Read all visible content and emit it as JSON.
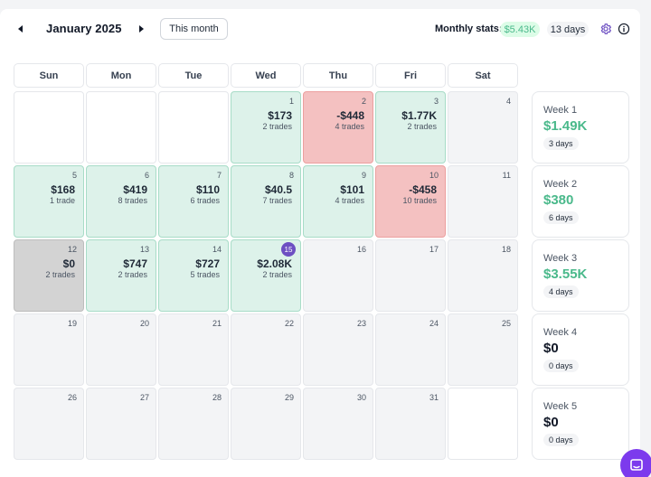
{
  "header": {
    "month_title": "January 2025",
    "this_month_label": "This month",
    "stats_label": "Monthly stats:",
    "stats_amount": "$5.43K",
    "stats_days": "13 days"
  },
  "weekdays": [
    "Sun",
    "Mon",
    "Tue",
    "Wed",
    "Thu",
    "Fri",
    "Sat"
  ],
  "weeks": [
    {
      "days": [
        {
          "date": "",
          "amount": "",
          "trades": "",
          "status": "blank"
        },
        {
          "date": "",
          "amount": "",
          "trades": "",
          "status": "blank"
        },
        {
          "date": "",
          "amount": "",
          "trades": "",
          "status": "blank"
        },
        {
          "date": "1",
          "amount": "$173",
          "trades": "2 trades",
          "status": "profit"
        },
        {
          "date": "2",
          "amount": "-$448",
          "trades": "4 trades",
          "status": "loss"
        },
        {
          "date": "3",
          "amount": "$1.77K",
          "trades": "2 trades",
          "status": "profit"
        },
        {
          "date": "4",
          "amount": "",
          "trades": "",
          "status": "empty"
        }
      ],
      "summary": {
        "label": "Week 1",
        "amount": "$1.49K",
        "days": "3 days",
        "positive": true
      }
    },
    {
      "days": [
        {
          "date": "5",
          "amount": "$168",
          "trades": "1 trade",
          "status": "profit"
        },
        {
          "date": "6",
          "amount": "$419",
          "trades": "8 trades",
          "status": "profit"
        },
        {
          "date": "7",
          "amount": "$110",
          "trades": "6 trades",
          "status": "profit"
        },
        {
          "date": "8",
          "amount": "$40.5",
          "trades": "7 trades",
          "status": "profit"
        },
        {
          "date": "9",
          "amount": "$101",
          "trades": "4 trades",
          "status": "profit"
        },
        {
          "date": "10",
          "amount": "-$458",
          "trades": "10 trades",
          "status": "loss"
        },
        {
          "date": "11",
          "amount": "",
          "trades": "",
          "status": "empty"
        }
      ],
      "summary": {
        "label": "Week 2",
        "amount": "$380",
        "days": "6 days",
        "positive": true
      }
    },
    {
      "days": [
        {
          "date": "12",
          "amount": "$0",
          "trades": "2 trades",
          "status": "flat"
        },
        {
          "date": "13",
          "amount": "$747",
          "trades": "2 trades",
          "status": "profit"
        },
        {
          "date": "14",
          "amount": "$727",
          "trades": "5 trades",
          "status": "profit"
        },
        {
          "date": "15",
          "amount": "$2.08K",
          "trades": "2 trades",
          "status": "profit",
          "today": true
        },
        {
          "date": "16",
          "amount": "",
          "trades": "",
          "status": "empty"
        },
        {
          "date": "17",
          "amount": "",
          "trades": "",
          "status": "empty"
        },
        {
          "date": "18",
          "amount": "",
          "trades": "",
          "status": "empty"
        }
      ],
      "summary": {
        "label": "Week 3",
        "amount": "$3.55K",
        "days": "4 days",
        "positive": true
      }
    },
    {
      "days": [
        {
          "date": "19",
          "amount": "",
          "trades": "",
          "status": "empty"
        },
        {
          "date": "20",
          "amount": "",
          "trades": "",
          "status": "empty"
        },
        {
          "date": "21",
          "amount": "",
          "trades": "",
          "status": "empty"
        },
        {
          "date": "22",
          "amount": "",
          "trades": "",
          "status": "empty"
        },
        {
          "date": "23",
          "amount": "",
          "trades": "",
          "status": "empty"
        },
        {
          "date": "24",
          "amount": "",
          "trades": "",
          "status": "empty"
        },
        {
          "date": "25",
          "amount": "",
          "trades": "",
          "status": "empty"
        }
      ],
      "summary": {
        "label": "Week 4",
        "amount": "$0",
        "days": "0 days",
        "positive": false
      }
    },
    {
      "days": [
        {
          "date": "26",
          "amount": "",
          "trades": "",
          "status": "empty"
        },
        {
          "date": "27",
          "amount": "",
          "trades": "",
          "status": "empty"
        },
        {
          "date": "28",
          "amount": "",
          "trades": "",
          "status": "empty"
        },
        {
          "date": "29",
          "amount": "",
          "trades": "",
          "status": "empty"
        },
        {
          "date": "30",
          "amount": "",
          "trades": "",
          "status": "empty"
        },
        {
          "date": "31",
          "amount": "",
          "trades": "",
          "status": "empty"
        },
        {
          "date": "",
          "amount": "",
          "trades": "",
          "status": "blank"
        }
      ],
      "summary": {
        "label": "Week 5",
        "amount": "$0",
        "days": "0 days",
        "positive": false
      }
    }
  ],
  "icons": {
    "prev": "caret-left-icon",
    "next": "caret-right-icon",
    "settings": "gear-icon",
    "info": "info-icon",
    "chat": "chat-icon"
  },
  "colors": {
    "profit_bg": "#ddf2ea",
    "loss_bg": "#f4c1c1",
    "flat_bg": "#d3d3d3",
    "positive_text": "#4ab98b",
    "today_badge": "#6d4fc2",
    "chat_button": "#7c3aed"
  }
}
